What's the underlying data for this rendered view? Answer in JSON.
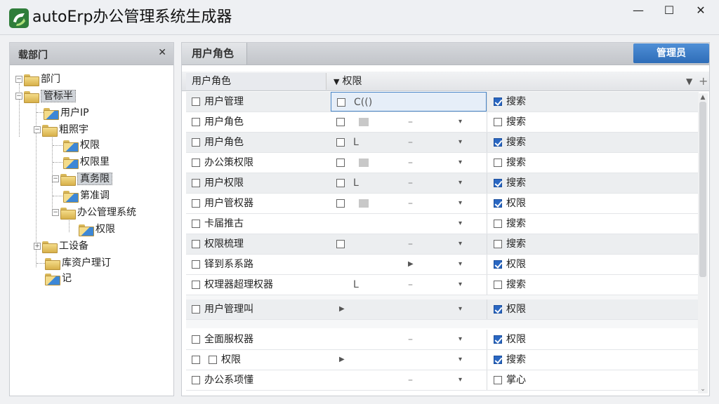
{
  "window": {
    "title": "autoErp办公管理系统生成器",
    "minimize": "—",
    "maximize": "☐",
    "close": "✕"
  },
  "left_panel": {
    "title": "载部门",
    "pin": "✕",
    "tree": [
      {
        "label": "部门",
        "level": 0,
        "expander": "−"
      },
      {
        "label": "管标半",
        "level": 0,
        "expander": "−",
        "selected": true
      },
      {
        "label": "用户IP",
        "level": 1
      },
      {
        "label": "粗照宇",
        "level": 1,
        "expander": "−"
      },
      {
        "label": "权限",
        "level": 2
      },
      {
        "label": "权限里",
        "level": 2
      },
      {
        "label": "真务限",
        "level": 2,
        "expander": "−",
        "selected": true
      },
      {
        "label": "第准调",
        "level": 2
      },
      {
        "label": "办公管理系统",
        "level": 2,
        "expander": "−"
      },
      {
        "label": "权限",
        "level": 3
      },
      {
        "label": "工设备",
        "level": 1,
        "expander": "+"
      },
      {
        "label": "库资户理订",
        "level": 1
      },
      {
        "label": "记",
        "level": 0
      }
    ]
  },
  "right_panel": {
    "tab_title": "用户角色",
    "action_button": "管理员",
    "columns": {
      "col1": "用户角色",
      "col2": "权限",
      "sort_arrow": "▼",
      "add": "+"
    },
    "rows": [
      {
        "name": "用户管理",
        "mid": "C(()",
        "checked_right": true,
        "right": "搜索",
        "shade": true,
        "focus": true
      },
      {
        "name": "用户角色",
        "mid": "",
        "checked_right": false,
        "right": "搜索",
        "blob": true
      },
      {
        "name": "用户角色",
        "mid": "L",
        "checked_right": true,
        "right": "搜索",
        "shade": true
      },
      {
        "name": "办公策权限",
        "mid": "",
        "checked_right": false,
        "right": "搜索",
        "blob": true
      },
      {
        "name": "用户权限",
        "mid": "L",
        "checked_right": true,
        "right": "搜索",
        "shade": true
      },
      {
        "name": "用户管权器",
        "mid": "",
        "checked_right": true,
        "right": "权限",
        "blob": true
      },
      {
        "name": "卡届推古",
        "mid": "",
        "checked_right": false,
        "right": "搜索"
      },
      {
        "name": "权限梳理",
        "mid": "",
        "checked_right": false,
        "right": "搜索",
        "shade": true
      },
      {
        "name": "铎到系系路",
        "mid": "",
        "checked_right": true,
        "right": "权限"
      },
      {
        "name": "权理器超理权器",
        "mid": "L",
        "checked_right": false,
        "right": "搜索"
      },
      {
        "name": "用户管理叫",
        "mid": "",
        "checked_right": true,
        "right": "权限",
        "shade": true
      },
      {
        "name": "全面服权器",
        "mid": "",
        "checked_right": true,
        "right": "权限"
      },
      {
        "name": "权限",
        "mid": "",
        "checked_right": true,
        "right": "搜索",
        "double_cb": true
      },
      {
        "name": "办公系项懂",
        "mid": "",
        "checked_right": false,
        "right": "掌心"
      }
    ]
  },
  "icons": {
    "app_logo": "autoerp-logo-icon",
    "folder": "folder-icon"
  }
}
